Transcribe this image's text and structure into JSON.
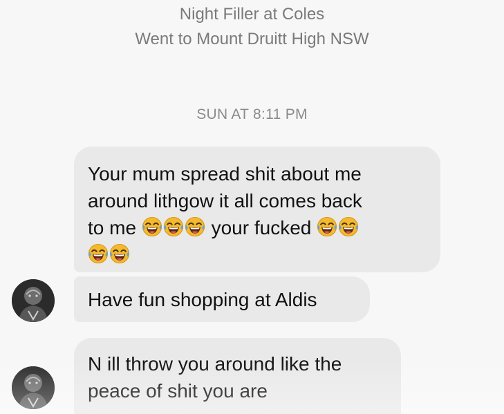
{
  "profile": {
    "job": "Night Filler at Coles",
    "school": "Went to Mount Druitt High NSW"
  },
  "conversation": {
    "timestamp": "SUN AT 8:11 PM",
    "messages": [
      {
        "lines": [
          "Your mum spread shit about me",
          "around lithgow it all comes back",
          "to me",
          "your fucked"
        ],
        "emoji": "face-with-tears-of-joy"
      },
      {
        "text": "Have fun shopping at Aldis"
      },
      {
        "lines": [
          "N ill throw you around like the",
          "peace of shit you are"
        ]
      }
    ]
  },
  "colors": {
    "background": "#f7f7f7",
    "bubble": "#e9e9e9",
    "meta_text": "#7a7a7a",
    "message_text": "#111111",
    "emoji_face": "#f5b92e"
  }
}
